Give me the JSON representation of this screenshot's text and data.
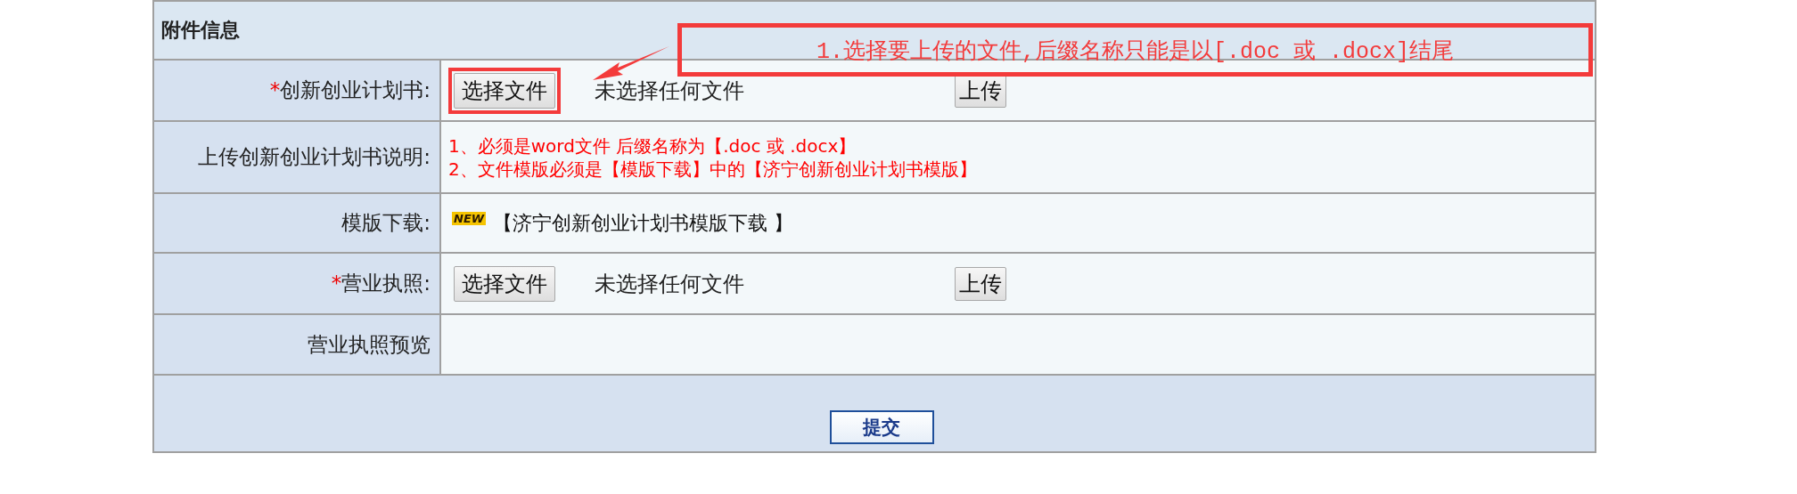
{
  "section": {
    "title": "附件信息"
  },
  "rows": [
    {
      "kind": "file",
      "required_mark": "*",
      "label": "创新创业计划书:",
      "choose_button": "选择文件",
      "file_status": "未选择任何文件",
      "upload_button": "上传",
      "highlighted": true
    },
    {
      "kind": "notes",
      "label": "上传创新创业计划书说明:",
      "lines": [
        "1、必须是word文件 后缀名称为【.doc 或 .docx】",
        "2、文件模版必须是【模版下载】中的【济宁创新创业计划书模版】"
      ]
    },
    {
      "kind": "download",
      "label": "模版下载:",
      "badge": "NEW",
      "link": "【济宁创新创业计划书模版下载 】"
    },
    {
      "kind": "file",
      "required_mark": "*",
      "label": "营业执照:",
      "choose_button": "选择文件",
      "file_status": "未选择任何文件",
      "upload_button": "上传",
      "highlighted": false
    },
    {
      "kind": "preview",
      "label": "营业执照预览"
    }
  ],
  "submit_button": "提交",
  "annotation": {
    "text": "1.选择要上传的文件,后缀名称只能是以[.doc 或 .docx]结尾"
  }
}
